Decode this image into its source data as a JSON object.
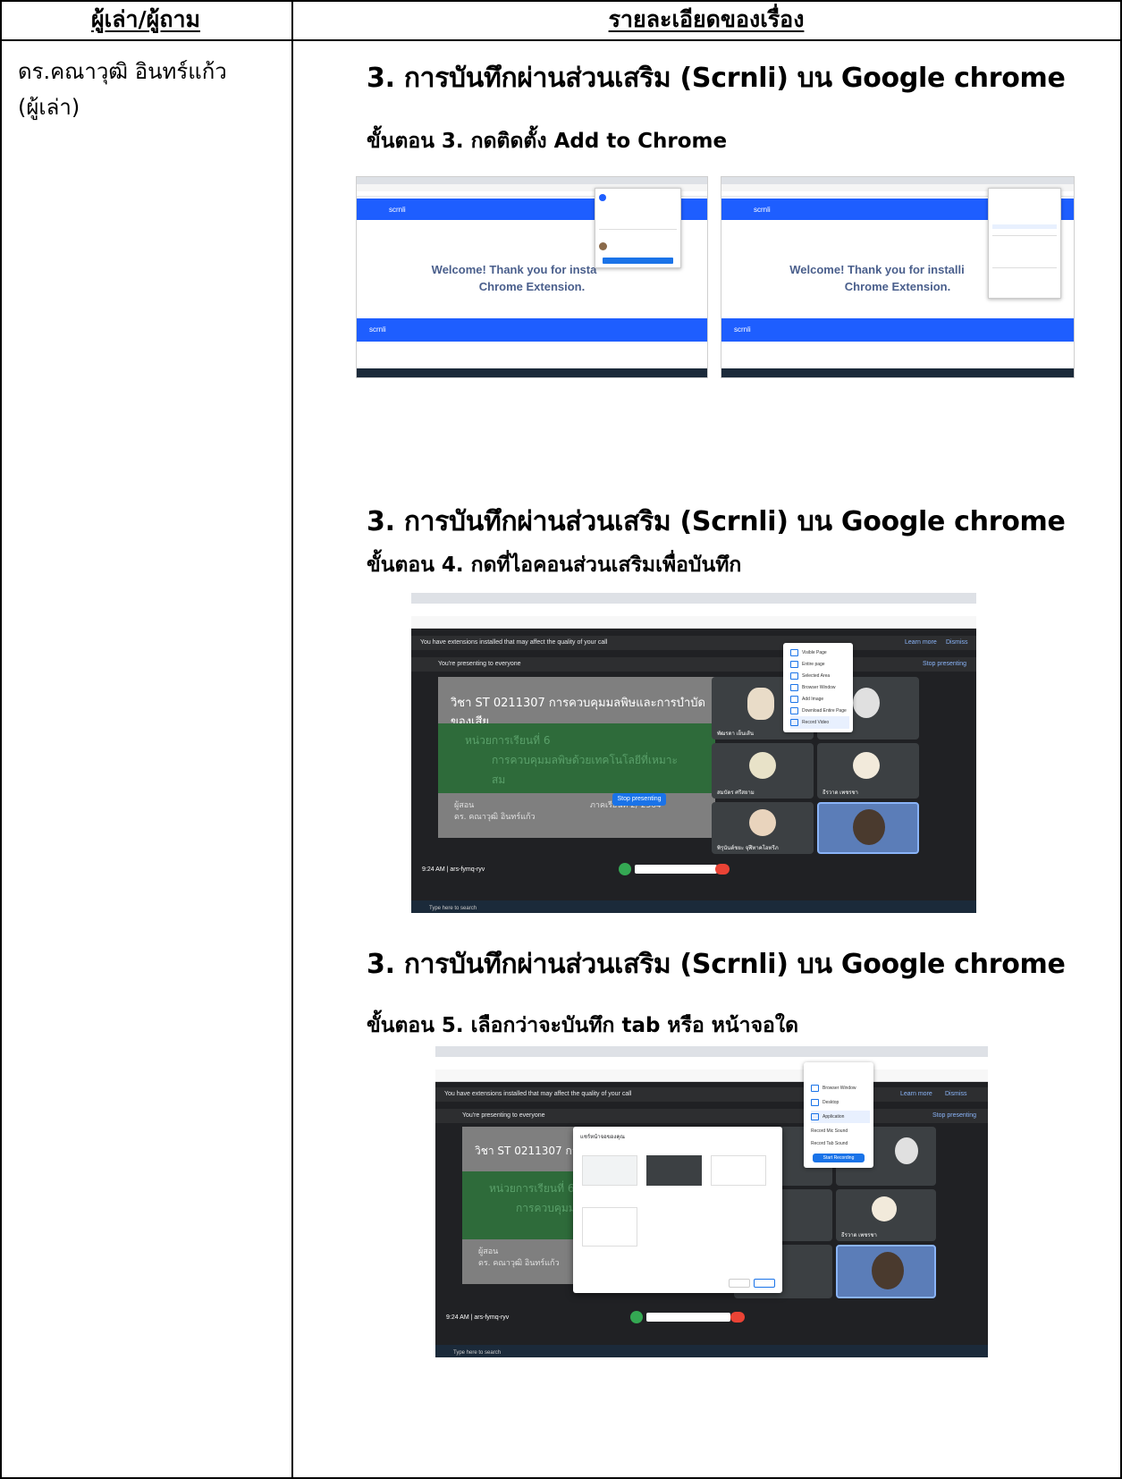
{
  "table": {
    "header_teller": "ผู้เล่า/ผู้ถาม",
    "header_detail": "รายละเอียดของเรื่อง",
    "teller_name": "ดร.คณาวุฒิ  อินทร์แก้ว",
    "teller_role": "(ผู้เล่า)"
  },
  "sections": [
    {
      "title": "3.  การบันทึกผ่านส่วนเสริม (Scrnli) บน Google chrome",
      "step": "ขั้นตอน 3. กดติดตั้ง Add to Chrome"
    },
    {
      "title": "3.  การบันทึกผ่านส่วนเสริม (Scrnli) บน Google chrome",
      "step": "ขั้นตอน 4. กดที่ไอคอนส่วนเสริมเพื่อบันทึก"
    },
    {
      "title": "3.  การบันทึกผ่านส่วนเสริม (Scrnli) บน Google chrome",
      "step": "ขั้นตอน 5. เลือกว่าจะบันทึก tab หรือ หน้าจอใด"
    }
  ],
  "screenshots": {
    "scrnli_logo": "scrnli",
    "welcome_line1_a": "Welcome! Thank you for insta",
    "welcome_line2": "Chrome Extension.",
    "welcome_line1_b": "Welcome! Thank you for installi",
    "meet_notice": "You have extensions installed that may affect the quality of your call",
    "meet_presenting": "You're presenting to everyone",
    "meet_stop_presenting": "Stop presenting",
    "slide_course": "วิชา ST 0211307 การควบคุมมลพิษและการบำบัดของเสีย",
    "slide_course_short": "วิชา ST 0211307 การควบคุม",
    "slide_unit": "หน่วยการเรียนที่ 6",
    "slide_topic": "การควบคุมมลพิษด้วยเทคโนโลยีที่เหมาะสม",
    "slide_topic_short": "การควบคุมมลพิษด้ว",
    "slide_lecturer_label": "ผู้สอน",
    "slide_lecturer": "ดร. คณาวุฒิ  อินทร์แก้ว",
    "slide_term": "ภาคเรียนที่ 2/ 2564",
    "meet_time_code": "9:24 AM  |  ars-fymq-ryv",
    "learn_more": "Learn more",
    "dismiss": "Dismiss",
    "menu_items": [
      "Visible Page",
      "Entire page",
      "Selected Area",
      "Browser Window",
      "Add Image",
      "Download Entire Page",
      "Record Video"
    ],
    "menu2_items": [
      "Browser Window",
      "Desktop",
      "Application",
      "Record Mic Sound",
      "Record Tab Sound",
      "Start Recording"
    ],
    "dialog_title": "แชร์หน้าจอของคุณ",
    "taskbar_search": "Type here to search",
    "participants": [
      "พัฒรดา เย็นเส้น",
      "สมบัตร ศรีสยาม",
      "ธีรวาด เพชรชา",
      "พิรุนันต์ชยะ จุฬีทาคโอทรีภ"
    ]
  },
  "colors": {
    "scrnli_blue": "#1e5eff",
    "meet_dark": "#202124",
    "slide_green": "#2e6b3a"
  }
}
